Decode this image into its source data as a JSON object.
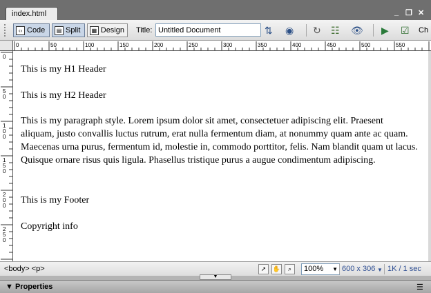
{
  "document_tab": {
    "label": "index.html"
  },
  "window_controls": {
    "minimize": "_",
    "restore": "❐",
    "close": "✕"
  },
  "toolbar": {
    "code_label": "Code",
    "split_label": "Split",
    "design_label": "Design",
    "title_label": "Title:",
    "title_value": "Untitled Document",
    "truncated_label": "Ch"
  },
  "ruler": {
    "h_labels": [
      "0",
      "50",
      "100",
      "150",
      "200",
      "250",
      "300",
      "350",
      "400",
      "450",
      "500",
      "550"
    ],
    "v_labels": [
      "0",
      "50",
      "100",
      "150",
      "200",
      "250"
    ]
  },
  "content": {
    "h1": "This is my H1 Header",
    "h2": "This is my H2 Header",
    "paragraph": "This is my paragraph style. Lorem ipsum dolor sit amet, consectetuer adipiscing elit. Praesent aliquam, justo convallis luctus rutrum, erat nulla fermentum diam, at nonummy quam ante ac quam. Maecenas urna purus, fermentum id, molestie in, commodo porttitor, felis. Nam blandit quam ut lacus. Quisque ornare risus quis ligula. Phasellus tristique purus a augue condimentum adipiscing.",
    "footer": "This is my Footer",
    "copyright": "Copyright info"
  },
  "status": {
    "tag_selector": "<body> <p>",
    "zoom": "100%",
    "window_size": "600 x 306",
    "download": "1K / 1 sec"
  },
  "panel": {
    "title": "Properties"
  }
}
